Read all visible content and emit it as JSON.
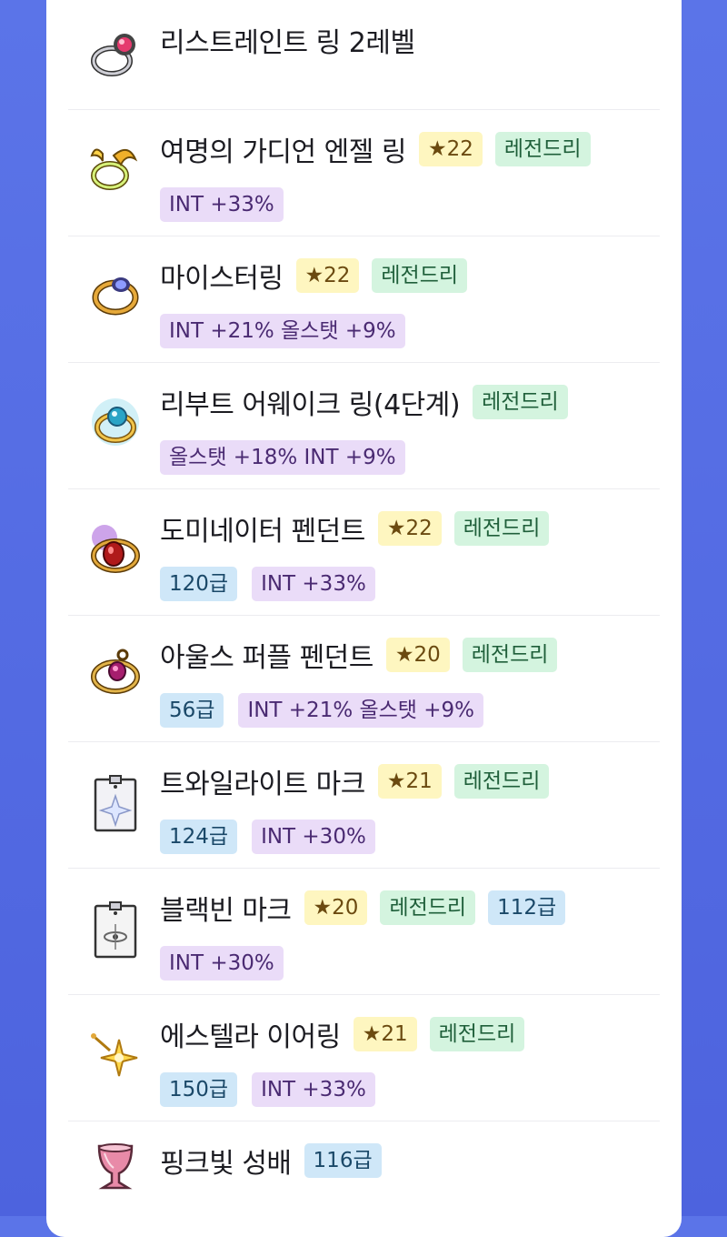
{
  "items": [
    {
      "name": "리스트레인트 링 2레벨",
      "icon": "ring-icon",
      "star": "",
      "rank": "",
      "grade": "",
      "stats": ""
    },
    {
      "name": "여명의 가디언 엔젤 링",
      "icon": "angel-ring-icon",
      "star": "★22",
      "rank": "레전드리",
      "grade": "",
      "stats": "INT +33%"
    },
    {
      "name": "마이스터링",
      "icon": "meister-ring-icon",
      "star": "★22",
      "rank": "레전드리",
      "grade": "",
      "stats": "INT +21% 올스탯 +9%"
    },
    {
      "name": "리부트 어웨이크 링(4단계)",
      "icon": "awake-ring-icon",
      "star": "",
      "rank": "레전드리",
      "grade": "",
      "stats": "올스탯 +18% INT +9%"
    },
    {
      "name": "도미네이터 펜던트",
      "icon": "pendant-icon",
      "star": "★22",
      "rank": "레전드리",
      "grade": "120급",
      "stats": "INT +33%"
    },
    {
      "name": "아울스 퍼플 펜던트",
      "icon": "purple-pendant-icon",
      "star": "★20",
      "rank": "레전드리",
      "grade": "56급",
      "stats": "INT +21% 올스탯 +9%"
    },
    {
      "name": "트와일라이트 마크",
      "icon": "twilight-mark-icon",
      "star": "★21",
      "rank": "레전드리",
      "grade": "124급",
      "stats": "INT +30%"
    },
    {
      "name": "블랙빈 마크",
      "icon": "blackbean-mark-icon",
      "star": "★20",
      "rank": "레전드리",
      "grade": "112급",
      "stats": "INT +30%"
    },
    {
      "name": "에스텔라 이어링",
      "icon": "earring-icon",
      "star": "★21",
      "rank": "레전드리",
      "grade": "150급",
      "stats": "INT +33%"
    },
    {
      "name": "핑크빛 성배",
      "icon": "grail-icon",
      "star": "",
      "rank": "",
      "grade": "116급",
      "stats": ""
    }
  ]
}
